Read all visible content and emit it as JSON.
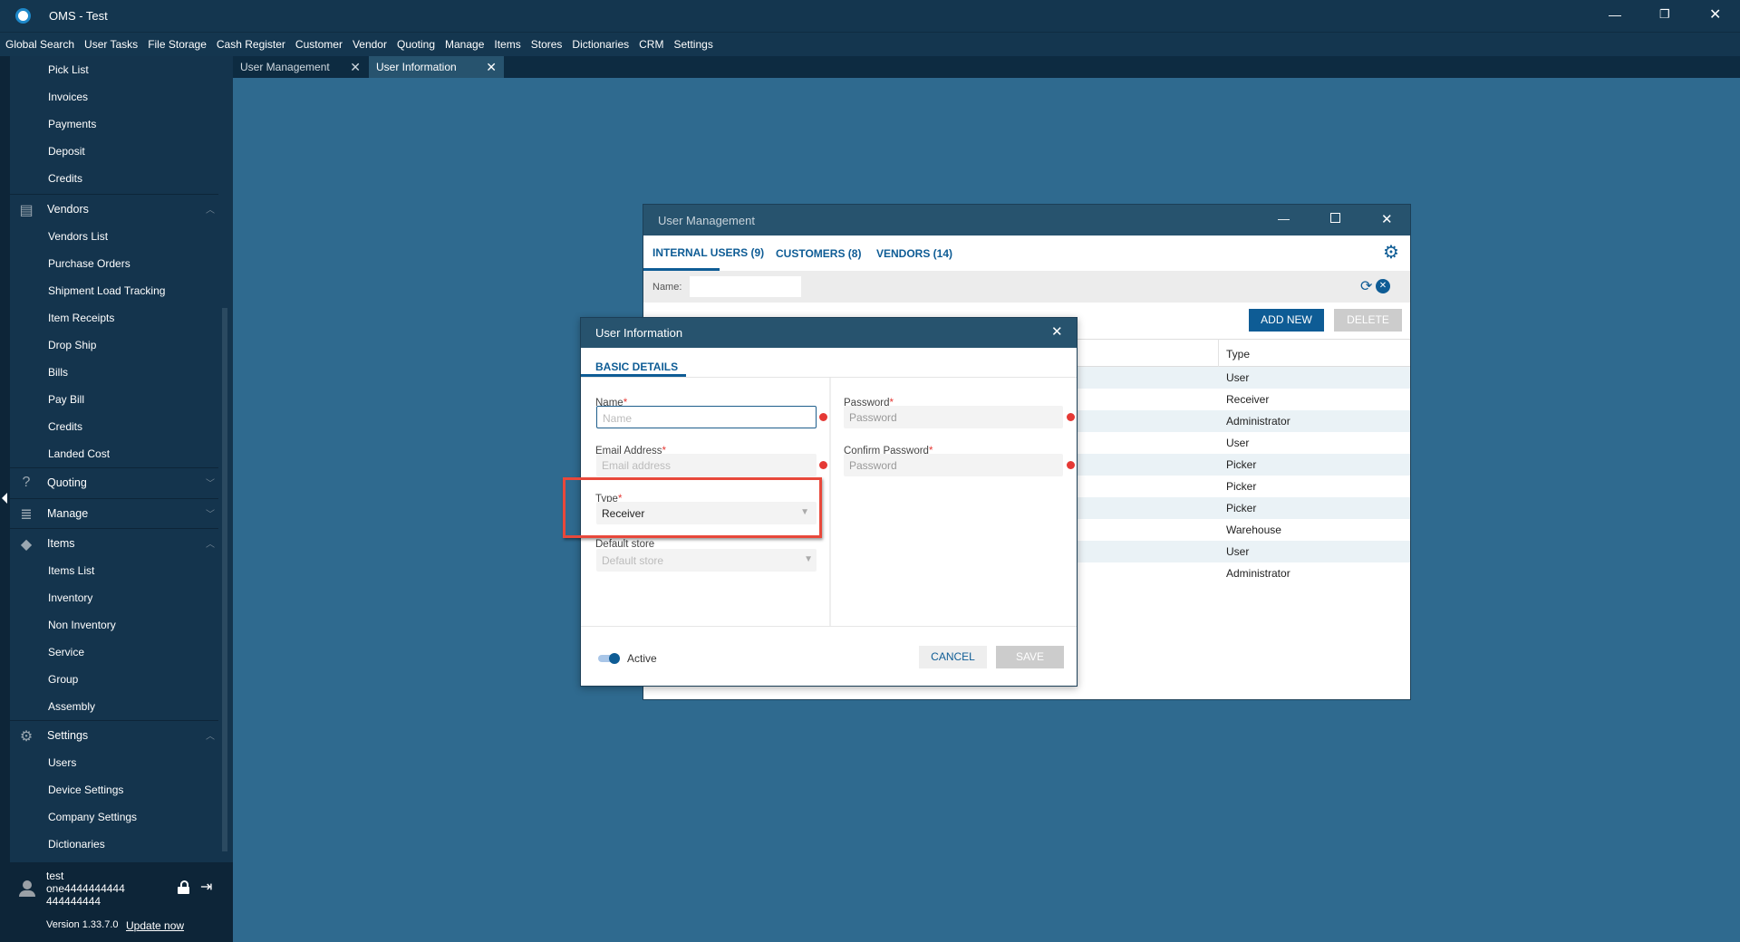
{
  "app": {
    "title": "OMS - Test"
  },
  "menu": [
    "Global Search",
    "User Tasks",
    "File Storage",
    "Cash Register",
    "Customer",
    "Vendor",
    "Quoting",
    "Manage",
    "Items",
    "Stores",
    "Dictionaries",
    "CRM",
    "Settings"
  ],
  "doc_tabs": [
    {
      "label": "User Management"
    },
    {
      "label": "User Information",
      "active": true
    }
  ],
  "sidebar": {
    "top_items": [
      "Pick List",
      "Invoices",
      "Payments",
      "Deposit",
      "Credits"
    ],
    "vendors": {
      "label": "Vendors",
      "items": [
        "Vendors List",
        "Purchase Orders",
        "Shipment Load Tracking",
        "Item Receipts",
        "Drop Ship",
        "Bills",
        "Pay Bill",
        "Credits",
        "Landed Cost"
      ]
    },
    "quoting": {
      "label": "Quoting"
    },
    "manage": {
      "label": "Manage"
    },
    "items": {
      "label": "Items",
      "items": [
        "Items List",
        "Inventory",
        "Non Inventory",
        "Service",
        "Group",
        "Assembly"
      ]
    },
    "settings": {
      "label": "Settings",
      "items": [
        "Users",
        "Device Settings",
        "Company Settings",
        "Dictionaries"
      ]
    },
    "user": {
      "line1": "test",
      "line2": "one4444444444",
      "line3": "444444444"
    },
    "version": "Version 1.33.7.0",
    "update": "Update now"
  },
  "user_management": {
    "title": "User Management",
    "tabs": [
      "INTERNAL USERS (9)",
      "CUSTOMERS (8)",
      "VENDORS (14)"
    ],
    "filter_label": "Name:",
    "filter_value": "",
    "add_new": "ADD NEW",
    "delete": "DELETE",
    "column_type": "Type",
    "rows": [
      "User",
      "Receiver",
      "Administrator",
      "User",
      "Picker",
      "Picker",
      "Picker",
      "Warehouse",
      "User",
      "Administrator"
    ]
  },
  "user_info": {
    "title": "User Information",
    "tab": "BASIC DETAILS",
    "name_label": "Name",
    "name_placeholder": "Name",
    "email_label": "Email Address",
    "email_placeholder": "Email address",
    "type_label": "Type",
    "type_value": "Receiver",
    "store_label": "Default store",
    "store_placeholder": "Default store",
    "password_label": "Password",
    "password_placeholder": "Password",
    "confirm_label": "Confirm Password",
    "confirm_placeholder": "Password",
    "active_label": "Active",
    "active": true,
    "cancel": "CANCEL",
    "save": "SAVE"
  },
  "colors": {
    "accent": "#0e5c95",
    "required": "#e53935",
    "highlight": "#e8483b"
  }
}
